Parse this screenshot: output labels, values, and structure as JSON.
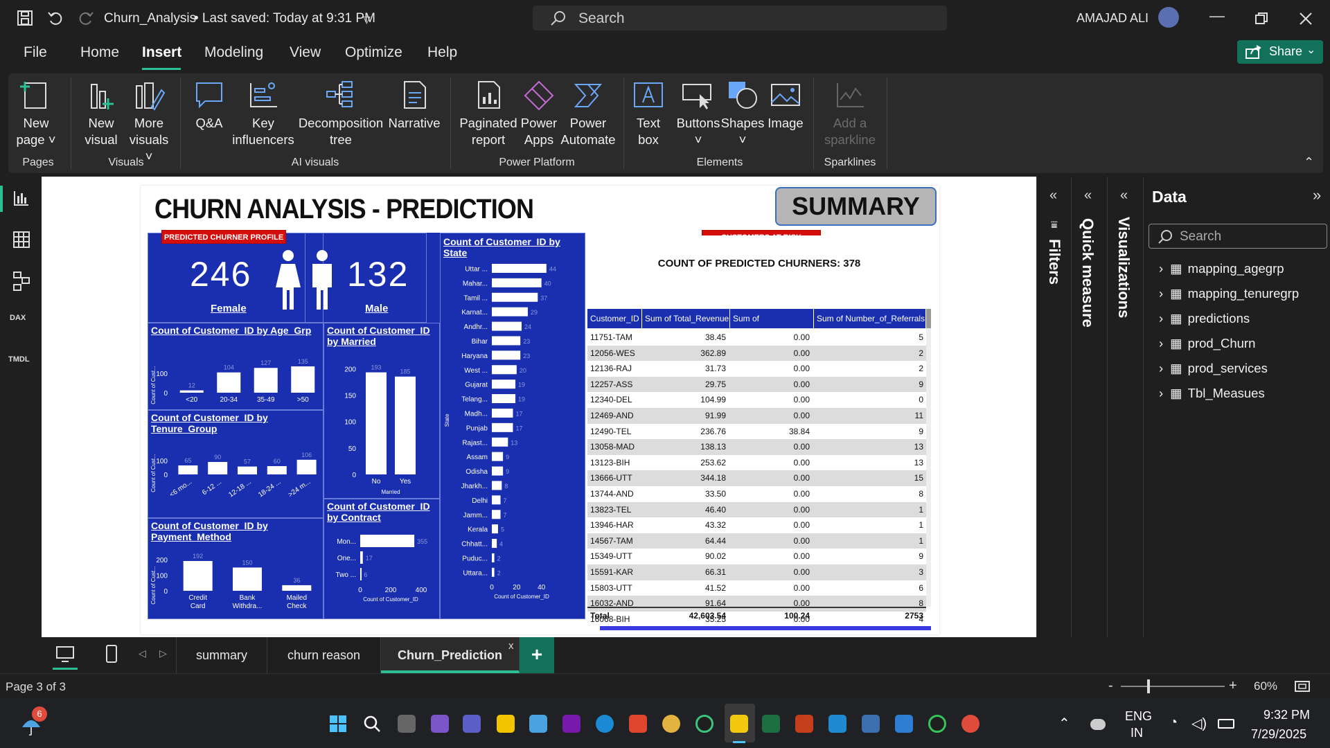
{
  "titlebar": {
    "file_title": "Churn_Analysis",
    "saved": "• Last saved: Today at 9:31 PM",
    "search": "Search",
    "user": "AMAJAD ALI"
  },
  "menu": {
    "items": [
      "File",
      "Home",
      "Insert",
      "Modeling",
      "View",
      "Optimize",
      "Help"
    ],
    "active": "Insert",
    "share": "Share"
  },
  "ribbon": {
    "new_page": [
      "New",
      "page ˅"
    ],
    "new_visual": [
      "New",
      "visual"
    ],
    "more_visuals": [
      "More",
      "visuals ˅"
    ],
    "qa": "Q&A",
    "key_infl": [
      "Key",
      "influencers"
    ],
    "decomp": [
      "Decomposition",
      "tree"
    ],
    "narrative": "Narrative",
    "paginated": [
      "Paginated",
      "report"
    ],
    "power_apps": [
      "Power",
      "Apps"
    ],
    "power_automate": [
      "Power",
      "Automate"
    ],
    "text_box": [
      "Text",
      "box"
    ],
    "buttons": [
      "Buttons",
      "˅"
    ],
    "shapes": [
      "Shapes",
      "˅"
    ],
    "image": "Image",
    "sparkline": [
      "Add a",
      "sparkline"
    ],
    "groups": {
      "pages": "Pages",
      "visuals": "Visuals",
      "ai": "AI visuals",
      "pp": "Power Platform",
      "elements": "Elements",
      "sparklines": "Sparklines"
    }
  },
  "report": {
    "title": "CHURN ANALYSIS - PREDICTION",
    "summary_btn": "SUMMARY",
    "pill_profile": "PREDICTED CHURNER PROFILE",
    "pill_risk": "CUSTOMERS AT RISK",
    "female_count": "246",
    "female_label": "Female",
    "male_count": "132",
    "male_label": "Male",
    "age_title": "Count of Customer_ID by Age_Grp",
    "married_title": "Count of Customer_ID by Married",
    "tenure_title": "Count of Customer_ID by Tenure_Group",
    "payment_title": "Count of Customer_ID by Payment_Method",
    "contract_title": "Count of Customer_ID by Contract",
    "state_title": "Count of Customer_ID by State",
    "ylabel_short": "Count of Cust...",
    "state_axis": "State",
    "count_axis": "Count of Customer_ID",
    "married_axis": "Married",
    "churner_count": "COUNT OF PREDICTED CHURNERS: 378"
  },
  "chart_data": [
    {
      "type": "bar",
      "title": "Count of Customer_ID by Age_Grp",
      "categories": [
        "<20",
        "20-34",
        "35-49",
        ">50"
      ],
      "values": [
        12,
        104,
        127,
        135
      ],
      "ylabel": "Count of Cust...",
      "ticks": [
        "100",
        "0"
      ]
    },
    {
      "type": "bar",
      "title": "Count of Customer_ID by Married",
      "categories": [
        "No",
        "Yes"
      ],
      "values": [
        193,
        185
      ],
      "xlabel": "Married",
      "ticks": [
        "200",
        "150",
        "100",
        "50",
        "0"
      ]
    },
    {
      "type": "bar",
      "title": "Count of Customer_ID by Tenure_Group",
      "categories": [
        "<6 mo...",
        "6-12 ...",
        "12-18 ...",
        "18-24 ...",
        ">24 m..."
      ],
      "values": [
        65,
        90,
        57,
        60,
        106
      ],
      "ylabel": "Count of Cust...",
      "ticks": [
        "100",
        "0"
      ]
    },
    {
      "type": "bar",
      "title": "Count of Customer_ID by Payment_Method",
      "categories": [
        "Credit Card",
        "Bank Withdra...",
        "Mailed Check"
      ],
      "values": [
        192,
        150,
        36
      ],
      "ylabel": "Count of Cust...",
      "ticks": [
        "200",
        "100",
        "0"
      ]
    },
    {
      "type": "bar",
      "title": "Count of Customer_ID by Contract",
      "orientation": "horizontal",
      "categories": [
        "Mon...",
        "One...",
        "Two ..."
      ],
      "values": [
        355,
        17,
        6
      ],
      "xlabel": "Count of Customer_ID",
      "ticks": [
        "0",
        "200",
        "400"
      ]
    },
    {
      "type": "bar",
      "title": "Count of Customer_ID by State",
      "orientation": "horizontal",
      "categories": [
        "Uttar ...",
        "Mahar...",
        "Tamil ...",
        "Karnat...",
        "Andhr...",
        "Bihar",
        "Haryana",
        "West ...",
        "Gujarat",
        "Telang...",
        "Madh...",
        "Punjab",
        "Rajast...",
        "Assam",
        "Odisha",
        "Jharkh...",
        "Delhi",
        "Jamm...",
        "Kerala",
        "Chhatt...",
        "Puduc...",
        "Uttara..."
      ],
      "values": [
        44,
        40,
        37,
        29,
        24,
        23,
        23,
        20,
        19,
        19,
        17,
        17,
        13,
        9,
        9,
        8,
        7,
        7,
        5,
        4,
        2,
        2
      ],
      "ylabel": "State",
      "xlabel": "Count of Customer_ID",
      "ticks": [
        "0",
        "20",
        "40"
      ]
    }
  ],
  "table": {
    "headers": [
      "Customer_ID",
      "Sum of Total_Revenue",
      "Sum of Total_Refunds",
      "Sum of Number_of_Referrals"
    ],
    "rows": [
      [
        "11751-TAM",
        "38.45",
        "0.00",
        "5"
      ],
      [
        "12056-WES",
        "362.89",
        "0.00",
        "2"
      ],
      [
        "12136-RAJ",
        "31.73",
        "0.00",
        "2"
      ],
      [
        "12257-ASS",
        "29.75",
        "0.00",
        "9"
      ],
      [
        "12340-DEL",
        "104.99",
        "0.00",
        "0"
      ],
      [
        "12469-AND",
        "91.99",
        "0.00",
        "11"
      ],
      [
        "12490-TEL",
        "236.76",
        "38.84",
        "9"
      ],
      [
        "13058-MAD",
        "138.13",
        "0.00",
        "13"
      ],
      [
        "13123-BIH",
        "253.62",
        "0.00",
        "13"
      ],
      [
        "13666-UTT",
        "344.18",
        "0.00",
        "15"
      ],
      [
        "13744-AND",
        "33.50",
        "0.00",
        "8"
      ],
      [
        "13823-TEL",
        "46.40",
        "0.00",
        "1"
      ],
      [
        "13946-HAR",
        "43.32",
        "0.00",
        "1"
      ],
      [
        "14567-TAM",
        "64.44",
        "0.00",
        "1"
      ],
      [
        "15349-UTT",
        "90.02",
        "0.00",
        "9"
      ],
      [
        "15591-KAR",
        "66.31",
        "0.00",
        "3"
      ],
      [
        "15803-UTT",
        "41.52",
        "0.00",
        "6"
      ],
      [
        "16032-AND",
        "91.64",
        "0.00",
        "8"
      ],
      [
        "16068-BIH",
        "35.25",
        "0.00",
        "4"
      ]
    ],
    "total": [
      "Total",
      "42,603.54",
      "100.24",
      "2753"
    ]
  },
  "panes": {
    "filters": "Filters",
    "quick": "Quick measure",
    "viz": "Visualizations",
    "data": "Data",
    "search": "Search",
    "tables": [
      "mapping_agegrp",
      "mapping_tenuregrp",
      "predictions",
      "prod_Churn",
      "prod_services",
      "Tbl_Measues"
    ]
  },
  "pages": {
    "tabs": [
      "summary",
      "churn reason",
      "Churn_Prediction"
    ],
    "active": "Churn_Prediction",
    "add": "+",
    "close": "x"
  },
  "status": {
    "page": "Page 3 of 3",
    "zoom": "60%",
    "zoom_minus": "-",
    "zoom_plus": "+"
  },
  "taskbar": {
    "notif": "6",
    "lang1": "ENG",
    "lang2": "IN",
    "time": "9:32 PM",
    "date": "7/29/2025"
  },
  "colors": {
    "report_blue": "#1a2fb0",
    "accent_green": "#2bbf93",
    "pill_red": "#d40d0d"
  }
}
